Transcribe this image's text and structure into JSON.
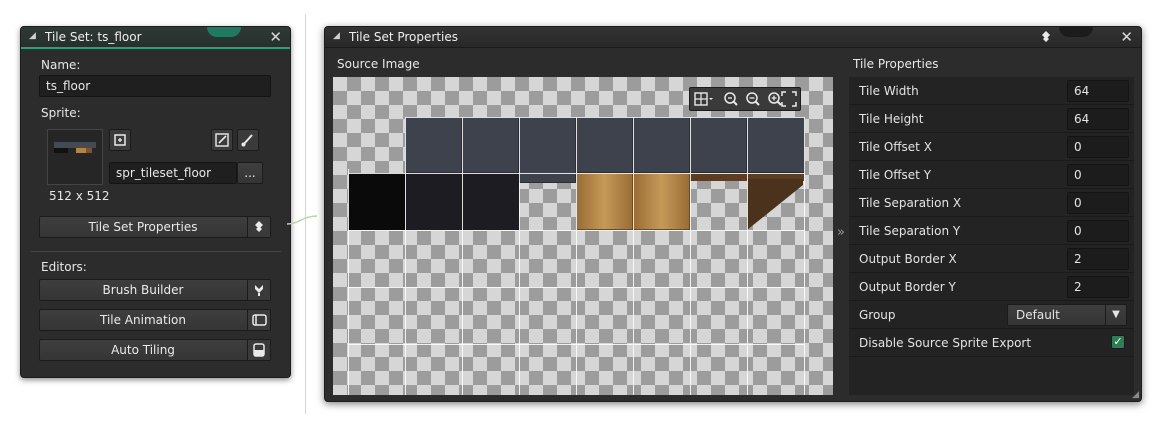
{
  "tileset_panel": {
    "title": "Tile Set: ts_floor",
    "name_label": "Name:",
    "name_value": "ts_floor",
    "sprite_label": "Sprite:",
    "sprite_value": "spr_tileset_floor",
    "sprite_browse": "...",
    "sprite_size": "512 x 512",
    "properties_button": "Tile Set Properties",
    "editors_label": "Editors:",
    "editors": [
      {
        "label": "Brush Builder",
        "icon": "brush-builder-icon"
      },
      {
        "label": "Tile Animation",
        "icon": "animation-icon"
      },
      {
        "label": "Auto Tiling",
        "icon": "auto-tiling-icon"
      }
    ],
    "accent_color": "#2e9e7b"
  },
  "properties_window": {
    "title": "Tile Set Properties",
    "source_label": "Source Image",
    "tile_props_label": "Tile Properties",
    "rows": [
      {
        "label": "Tile Width",
        "value": "64"
      },
      {
        "label": "Tile Height",
        "value": "64"
      },
      {
        "label": "Tile Offset X",
        "value": "0"
      },
      {
        "label": "Tile Offset Y",
        "value": "0"
      },
      {
        "label": "Tile Separation X",
        "value": "0"
      },
      {
        "label": "Tile Separation Y",
        "value": "0"
      },
      {
        "label": "Output Border X",
        "value": "2"
      },
      {
        "label": "Output Border Y",
        "value": "2"
      }
    ],
    "group_label": "Group",
    "group_value": "Default",
    "disable_export_label": "Disable Source Sprite Export",
    "disable_export_checked": true
  }
}
